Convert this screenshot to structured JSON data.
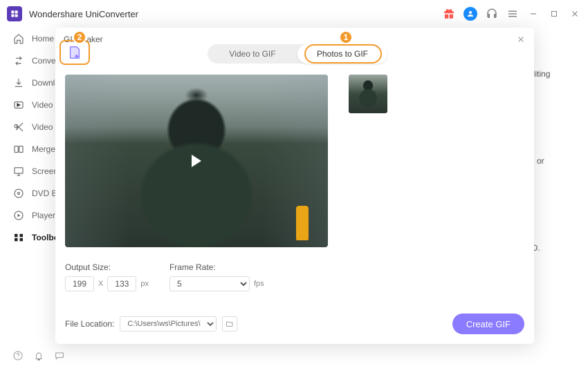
{
  "titlebar": {
    "title": "Wondershare UniConverter"
  },
  "sidebar": {
    "items": [
      {
        "label": "Home"
      },
      {
        "label": "Converter"
      },
      {
        "label": "Downloader"
      },
      {
        "label": "Video Compressor"
      },
      {
        "label": "Video Editor"
      },
      {
        "label": "Merger"
      },
      {
        "label": "Screen Recorder"
      },
      {
        "label": "DVD Burner"
      },
      {
        "label": "Player"
      },
      {
        "label": "Toolbox"
      }
    ]
  },
  "bg": {
    "hint1": "editing",
    "hint2": "ps or",
    "hint3": "CD."
  },
  "modal": {
    "title": "GIF Maker",
    "tabs": {
      "video": "Video to GIF",
      "photos": "Photos to GIF"
    },
    "badge1": "1",
    "badge2": "2",
    "output_size_label": "Output Size:",
    "frame_rate_label": "Frame Rate:",
    "width": "199",
    "x": "X",
    "height": "133",
    "px": "px",
    "fps_value": "5",
    "fps": "fps",
    "file_location_label": "File Location:",
    "file_location_value": "C:\\Users\\ws\\Pictures\\Wondersh",
    "create_label": "Create GIF"
  }
}
